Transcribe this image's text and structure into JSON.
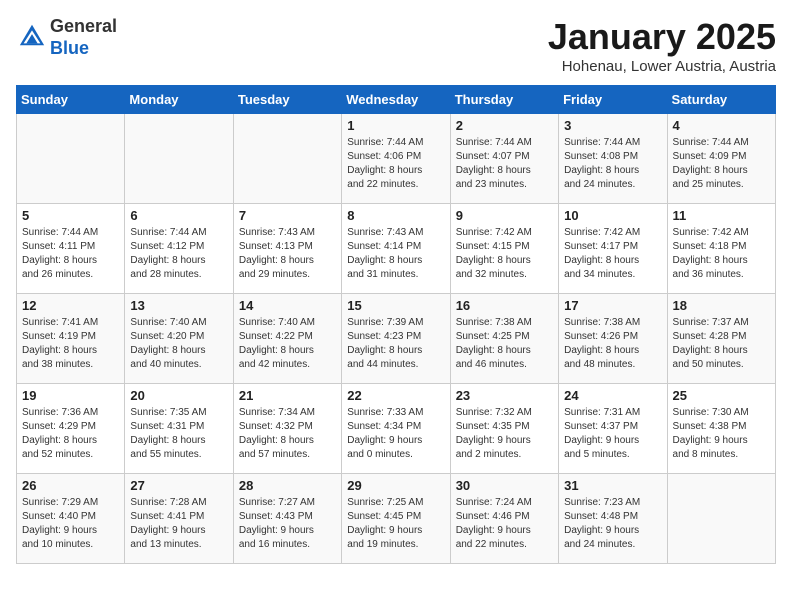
{
  "header": {
    "logo_general": "General",
    "logo_blue": "Blue",
    "month_title": "January 2025",
    "location": "Hohenau, Lower Austria, Austria"
  },
  "days_of_week": [
    "Sunday",
    "Monday",
    "Tuesday",
    "Wednesday",
    "Thursday",
    "Friday",
    "Saturday"
  ],
  "weeks": [
    [
      {
        "day": "",
        "info": ""
      },
      {
        "day": "",
        "info": ""
      },
      {
        "day": "",
        "info": ""
      },
      {
        "day": "1",
        "info": "Sunrise: 7:44 AM\nSunset: 4:06 PM\nDaylight: 8 hours\nand 22 minutes."
      },
      {
        "day": "2",
        "info": "Sunrise: 7:44 AM\nSunset: 4:07 PM\nDaylight: 8 hours\nand 23 minutes."
      },
      {
        "day": "3",
        "info": "Sunrise: 7:44 AM\nSunset: 4:08 PM\nDaylight: 8 hours\nand 24 minutes."
      },
      {
        "day": "4",
        "info": "Sunrise: 7:44 AM\nSunset: 4:09 PM\nDaylight: 8 hours\nand 25 minutes."
      }
    ],
    [
      {
        "day": "5",
        "info": "Sunrise: 7:44 AM\nSunset: 4:11 PM\nDaylight: 8 hours\nand 26 minutes."
      },
      {
        "day": "6",
        "info": "Sunrise: 7:44 AM\nSunset: 4:12 PM\nDaylight: 8 hours\nand 28 minutes."
      },
      {
        "day": "7",
        "info": "Sunrise: 7:43 AM\nSunset: 4:13 PM\nDaylight: 8 hours\nand 29 minutes."
      },
      {
        "day": "8",
        "info": "Sunrise: 7:43 AM\nSunset: 4:14 PM\nDaylight: 8 hours\nand 31 minutes."
      },
      {
        "day": "9",
        "info": "Sunrise: 7:42 AM\nSunset: 4:15 PM\nDaylight: 8 hours\nand 32 minutes."
      },
      {
        "day": "10",
        "info": "Sunrise: 7:42 AM\nSunset: 4:17 PM\nDaylight: 8 hours\nand 34 minutes."
      },
      {
        "day": "11",
        "info": "Sunrise: 7:42 AM\nSunset: 4:18 PM\nDaylight: 8 hours\nand 36 minutes."
      }
    ],
    [
      {
        "day": "12",
        "info": "Sunrise: 7:41 AM\nSunset: 4:19 PM\nDaylight: 8 hours\nand 38 minutes."
      },
      {
        "day": "13",
        "info": "Sunrise: 7:40 AM\nSunset: 4:20 PM\nDaylight: 8 hours\nand 40 minutes."
      },
      {
        "day": "14",
        "info": "Sunrise: 7:40 AM\nSunset: 4:22 PM\nDaylight: 8 hours\nand 42 minutes."
      },
      {
        "day": "15",
        "info": "Sunrise: 7:39 AM\nSunset: 4:23 PM\nDaylight: 8 hours\nand 44 minutes."
      },
      {
        "day": "16",
        "info": "Sunrise: 7:38 AM\nSunset: 4:25 PM\nDaylight: 8 hours\nand 46 minutes."
      },
      {
        "day": "17",
        "info": "Sunrise: 7:38 AM\nSunset: 4:26 PM\nDaylight: 8 hours\nand 48 minutes."
      },
      {
        "day": "18",
        "info": "Sunrise: 7:37 AM\nSunset: 4:28 PM\nDaylight: 8 hours\nand 50 minutes."
      }
    ],
    [
      {
        "day": "19",
        "info": "Sunrise: 7:36 AM\nSunset: 4:29 PM\nDaylight: 8 hours\nand 52 minutes."
      },
      {
        "day": "20",
        "info": "Sunrise: 7:35 AM\nSunset: 4:31 PM\nDaylight: 8 hours\nand 55 minutes."
      },
      {
        "day": "21",
        "info": "Sunrise: 7:34 AM\nSunset: 4:32 PM\nDaylight: 8 hours\nand 57 minutes."
      },
      {
        "day": "22",
        "info": "Sunrise: 7:33 AM\nSunset: 4:34 PM\nDaylight: 9 hours\nand 0 minutes."
      },
      {
        "day": "23",
        "info": "Sunrise: 7:32 AM\nSunset: 4:35 PM\nDaylight: 9 hours\nand 2 minutes."
      },
      {
        "day": "24",
        "info": "Sunrise: 7:31 AM\nSunset: 4:37 PM\nDaylight: 9 hours\nand 5 minutes."
      },
      {
        "day": "25",
        "info": "Sunrise: 7:30 AM\nSunset: 4:38 PM\nDaylight: 9 hours\nand 8 minutes."
      }
    ],
    [
      {
        "day": "26",
        "info": "Sunrise: 7:29 AM\nSunset: 4:40 PM\nDaylight: 9 hours\nand 10 minutes."
      },
      {
        "day": "27",
        "info": "Sunrise: 7:28 AM\nSunset: 4:41 PM\nDaylight: 9 hours\nand 13 minutes."
      },
      {
        "day": "28",
        "info": "Sunrise: 7:27 AM\nSunset: 4:43 PM\nDaylight: 9 hours\nand 16 minutes."
      },
      {
        "day": "29",
        "info": "Sunrise: 7:25 AM\nSunset: 4:45 PM\nDaylight: 9 hours\nand 19 minutes."
      },
      {
        "day": "30",
        "info": "Sunrise: 7:24 AM\nSunset: 4:46 PM\nDaylight: 9 hours\nand 22 minutes."
      },
      {
        "day": "31",
        "info": "Sunrise: 7:23 AM\nSunset: 4:48 PM\nDaylight: 9 hours\nand 24 minutes."
      },
      {
        "day": "",
        "info": ""
      }
    ]
  ]
}
